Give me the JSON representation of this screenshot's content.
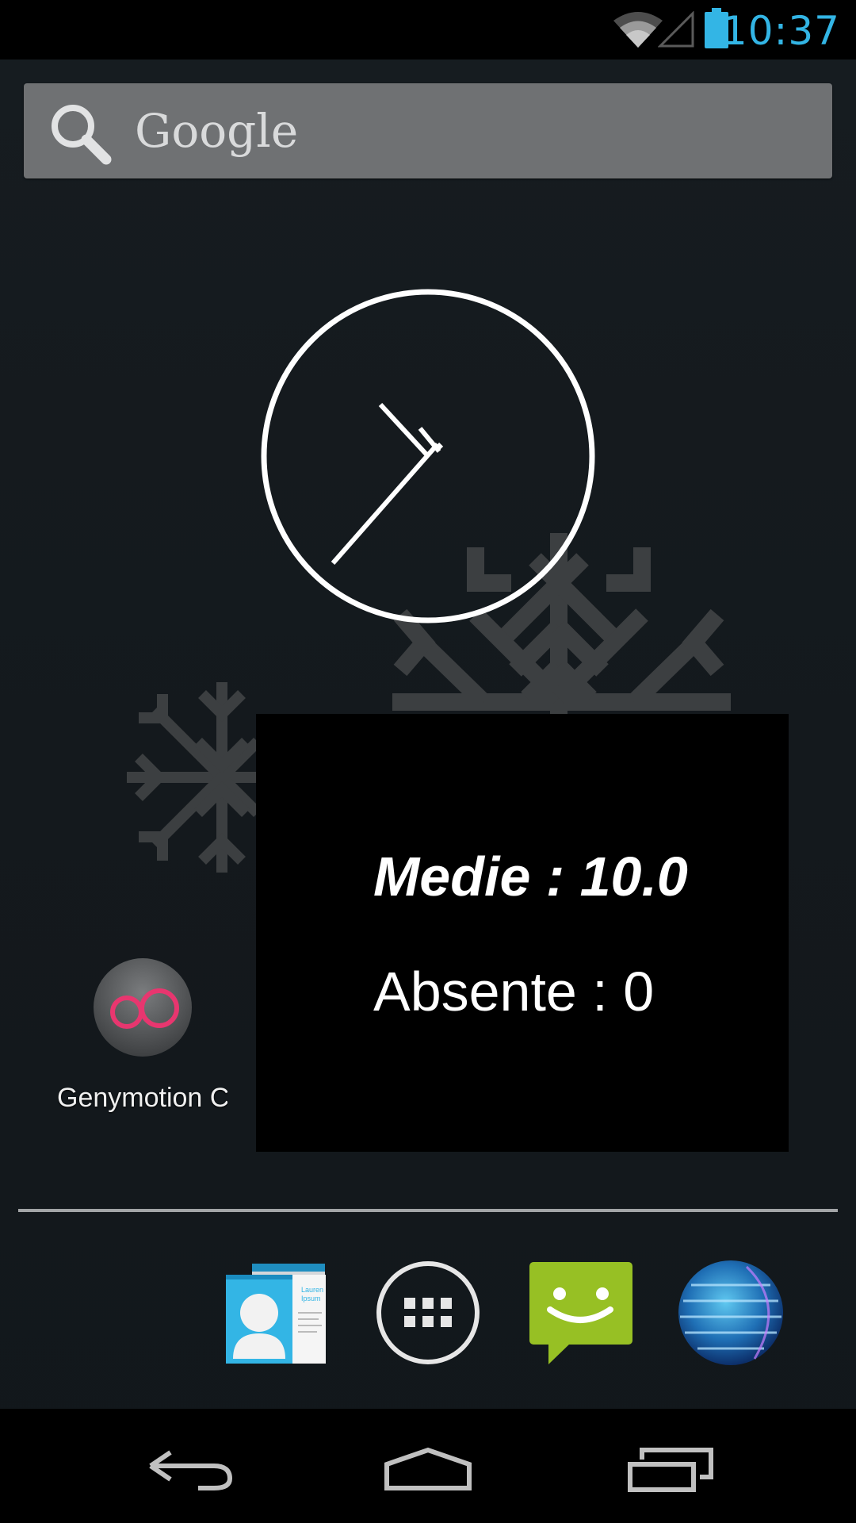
{
  "status_bar": {
    "time": "10:37",
    "icons": [
      "wifi-icon",
      "cell-signal-icon",
      "battery-icon"
    ],
    "time_color": "#33b5e5"
  },
  "search": {
    "logo_text": "Google",
    "icon": "search-icon"
  },
  "clock_widget": {
    "type": "analog"
  },
  "toast": {
    "medie": "Medie : 10.0",
    "absente": "Absente : 0"
  },
  "home_apps": [
    {
      "label": "Genymotion C",
      "icon": "genymotion-icon"
    }
  ],
  "dock": [
    {
      "icon": "contacts-icon"
    },
    {
      "icon": "all-apps-icon"
    },
    {
      "icon": "messaging-icon"
    },
    {
      "icon": "browser-globe-icon"
    }
  ],
  "nav_bar": {
    "buttons": [
      "back-icon",
      "home-icon",
      "recents-icon"
    ]
  },
  "colors": {
    "toast_bg": "#000000",
    "genymotion_accent": "#e8366f",
    "messaging_green": "#97c024",
    "contacts_blue": "#33b5e5"
  }
}
